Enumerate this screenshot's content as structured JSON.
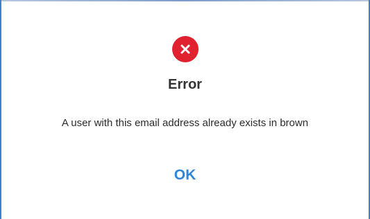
{
  "dialog": {
    "icon": "error-x-icon",
    "title": "Error",
    "message": "A user with this email address already exists in brown",
    "ok_label": "OK"
  },
  "colors": {
    "error_red": "#e0212f",
    "accent_blue": "#2f86d8",
    "border_blue": "#3d7fd1"
  }
}
